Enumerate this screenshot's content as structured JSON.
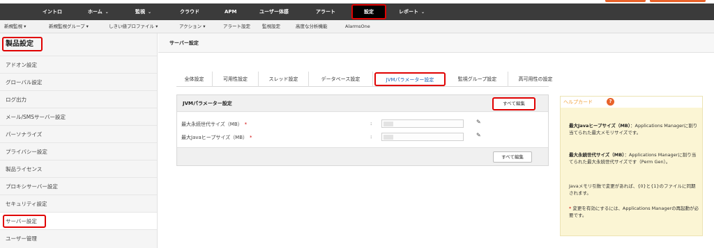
{
  "nav": {
    "items": [
      {
        "label": "イントロ",
        "caret": ""
      },
      {
        "label": "ホーム",
        "caret": "⌄"
      },
      {
        "label": "監視",
        "caret": "⌄"
      },
      {
        "label": "クラウド",
        "caret": ""
      },
      {
        "label": "APM",
        "caret": ""
      },
      {
        "label": "ユーザー体感",
        "caret": ""
      },
      {
        "label": "アラート",
        "caret": ""
      },
      {
        "label": "設定",
        "caret": ""
      },
      {
        "label": "レポート",
        "caret": "⌄"
      }
    ],
    "active_index": 7
  },
  "subnav": {
    "items": [
      "新規監視 ▾",
      "新規監視グループ ▾",
      "しきい値プロファイル ▾",
      "アクション ▾",
      "アラート設定",
      "監視設定",
      "高度な分析機能",
      "AlarmsOne"
    ]
  },
  "sidebar": {
    "title": "製品設定",
    "items": [
      "アドオン設定",
      "グローバル設定",
      "ログ出力",
      "メール/SMSサーバー設定",
      "パーソナライズ",
      "プライバシー設定",
      "製品ライセンス",
      "プロキシサーバー設定",
      "セキュリティ設定",
      "サーバー設定",
      "ユーザー管理"
    ],
    "active_index": 9
  },
  "page": {
    "title": "サーバー設定"
  },
  "tabs": {
    "items": [
      "全体設定",
      "可用性設定",
      "スレッド設定",
      "データベース設定",
      "JVMパラメーター設定",
      "監視グループ設定",
      "高可用性の設定"
    ],
    "active_index": 4
  },
  "panel": {
    "title": "JVMパラメーター設定",
    "edit_all_label": "すべて編集",
    "fields": [
      {
        "label": "最大永続世代サイズ（MB）",
        "required": "*",
        "colon": ":"
      },
      {
        "label": "最大Javaヒープサイズ（MB）",
        "required": "*",
        "colon": ":"
      }
    ]
  },
  "help": {
    "title": "ヘルプカード",
    "q_icon": "?",
    "para1_bold": "最大Javaヒープサイズ（MB）",
    "para1_text": "：Applications Managerに割り当てられた最大メモリサイズです。",
    "para2_bold": "最大永続世代サイズ（MB）",
    "para2_text": "：Applications Managerに割り当てられた最大永続世代サイズです（Perm Gen）。",
    "para3_text": "Javaメモリ引数で変更があれば、{0}と{1}のファイルに同期されます。",
    "para4_asterisk": "*",
    "para4_text": "変更を有効にするには、Applications Managerの再起動が必要です。"
  },
  "colors": {
    "nav_bg": "#3b3b3b",
    "highlight_red": "#e00000",
    "accent_orange": "#e8622a",
    "help_bg": "#fbf5d4",
    "active_tab_text": "#1a5fb4"
  }
}
